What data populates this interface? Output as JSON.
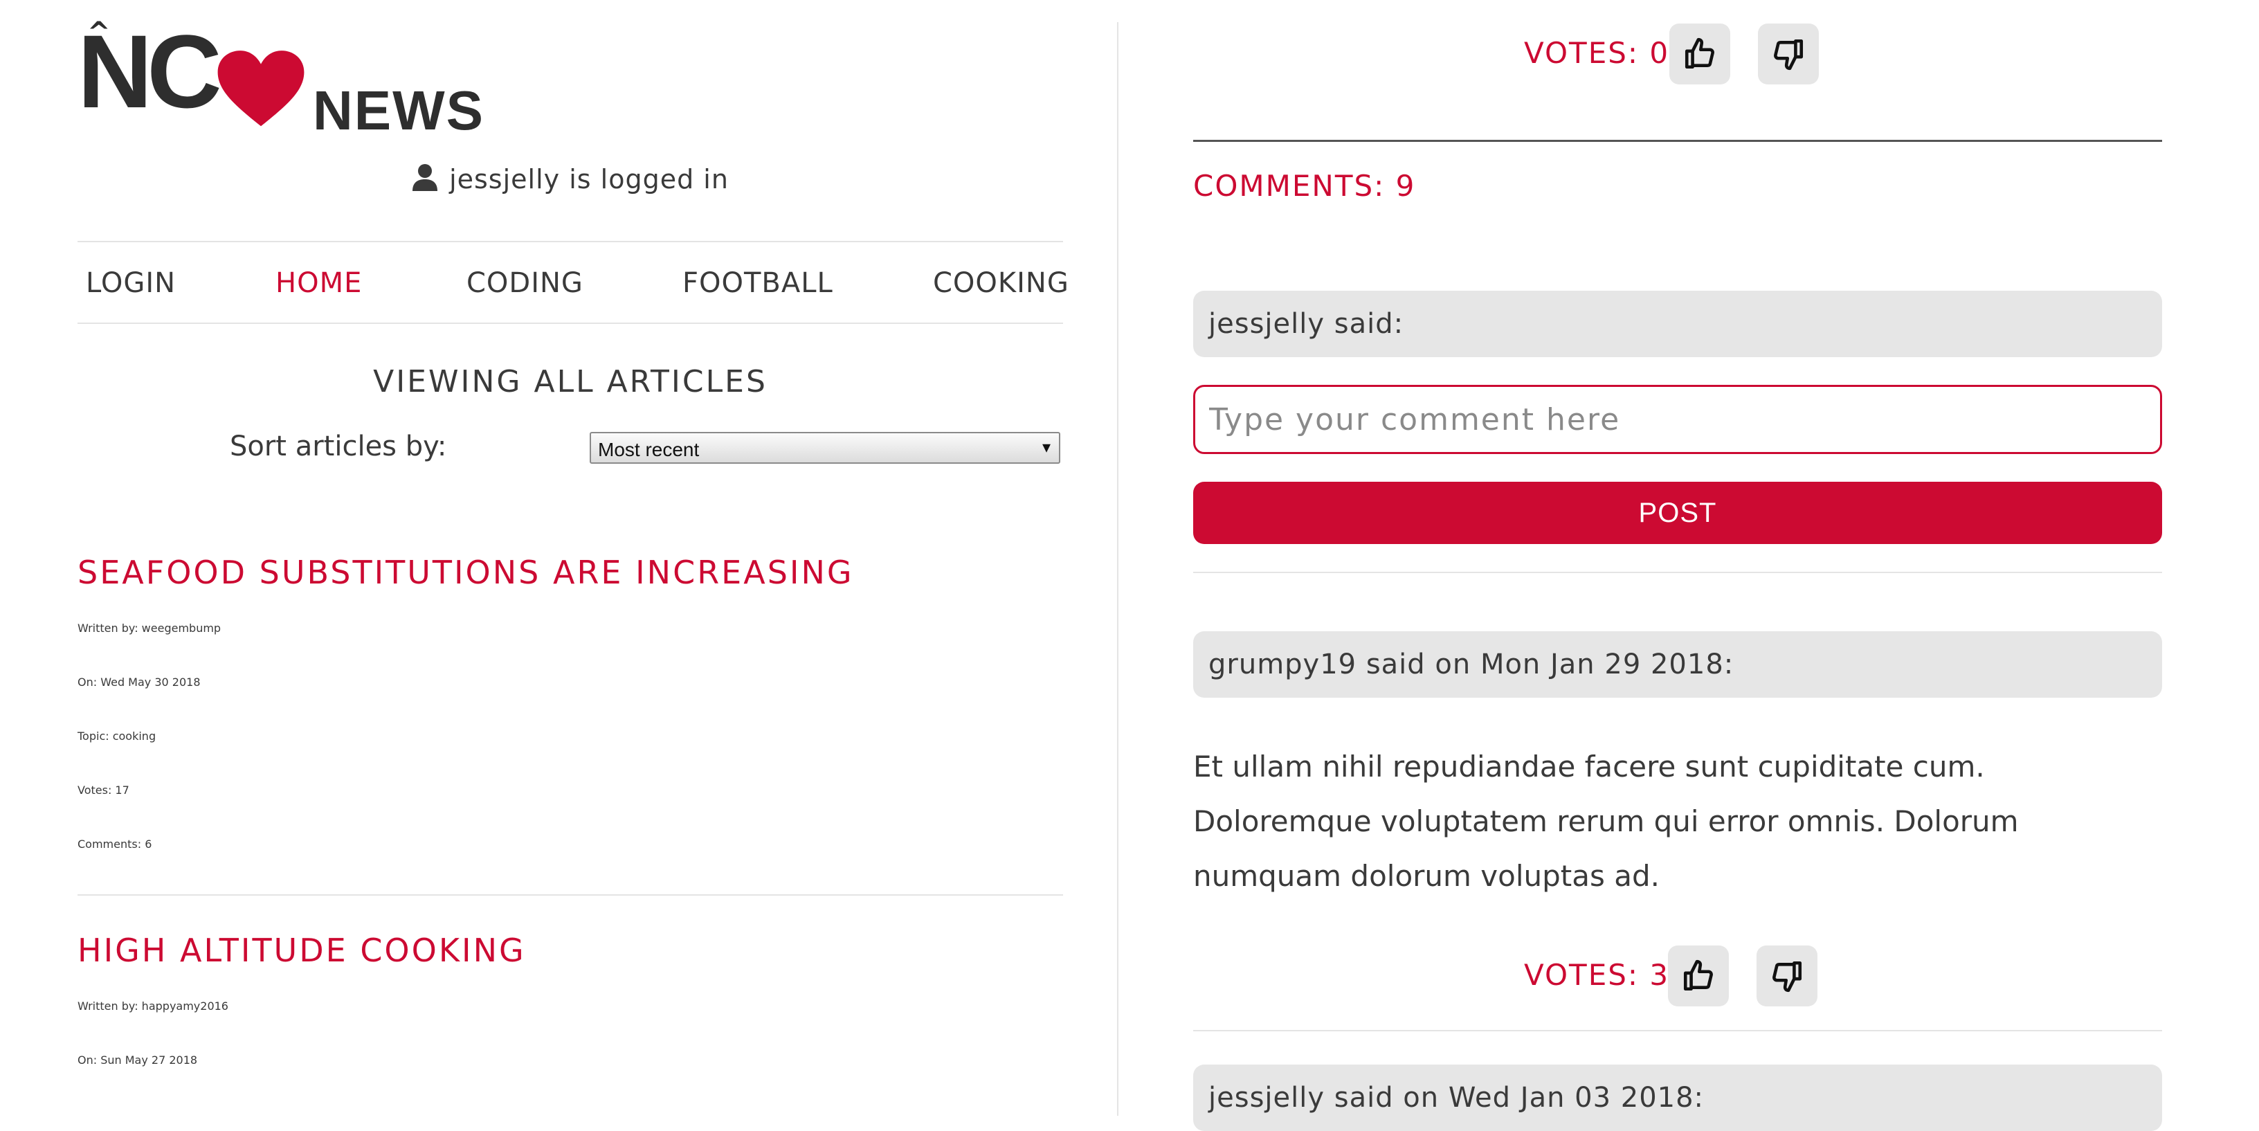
{
  "header": {
    "logo_left": "NC",
    "logo_right": "NEWS",
    "logged_in_text": "jessjelly is logged in"
  },
  "nav": {
    "items": [
      {
        "label": "LOGIN"
      },
      {
        "label": "HOME",
        "active": true
      },
      {
        "label": "CODING"
      },
      {
        "label": "FOOTBALL"
      },
      {
        "label": "COOKING"
      }
    ]
  },
  "articles_panel": {
    "heading": "VIEWING ALL ARTICLES",
    "sort_label": "Sort articles by:",
    "sort_selected": "Most recent",
    "articles": [
      {
        "title": "SEAFOOD SUBSTITUTIONS ARE INCREASING",
        "author": "Written by: weegembump",
        "date": "On: Wed May 30 2018",
        "topic": "Topic: cooking",
        "votes": "Votes: 17",
        "comments": "Comments: 6"
      },
      {
        "title": "HIGH ALTITUDE COOKING",
        "author": "Written by: happyamy2016",
        "date": "On: Sun May 27 2018"
      }
    ]
  },
  "article_detail": {
    "votes_label": "VOTES: 0",
    "comments_count": "COMMENTS: 9",
    "new_comment": {
      "said_label": "jessjelly said:",
      "placeholder": "Type your comment here",
      "post_label": "POST"
    },
    "comments": [
      {
        "header": "grumpy19 said on Mon Jan 29 2018:",
        "lines": [
          "Et ullam nihil repudiandae facere sunt cupiditate cum.",
          "Doloremque voluptatem rerum qui error omnis. Dolorum",
          "numquam dolorum voluptas ad."
        ],
        "votes_label": "VOTES: 3"
      },
      {
        "header": "jessjelly said on Wed Jan 03 2018:"
      }
    ]
  },
  "colors": {
    "accent": "#cc0a32",
    "text": "#3a3a3a",
    "button_bg": "#e6e6e6"
  },
  "icons": [
    "user-icon",
    "heart-icon",
    "thumbs-up-icon",
    "thumbs-down-icon"
  ]
}
